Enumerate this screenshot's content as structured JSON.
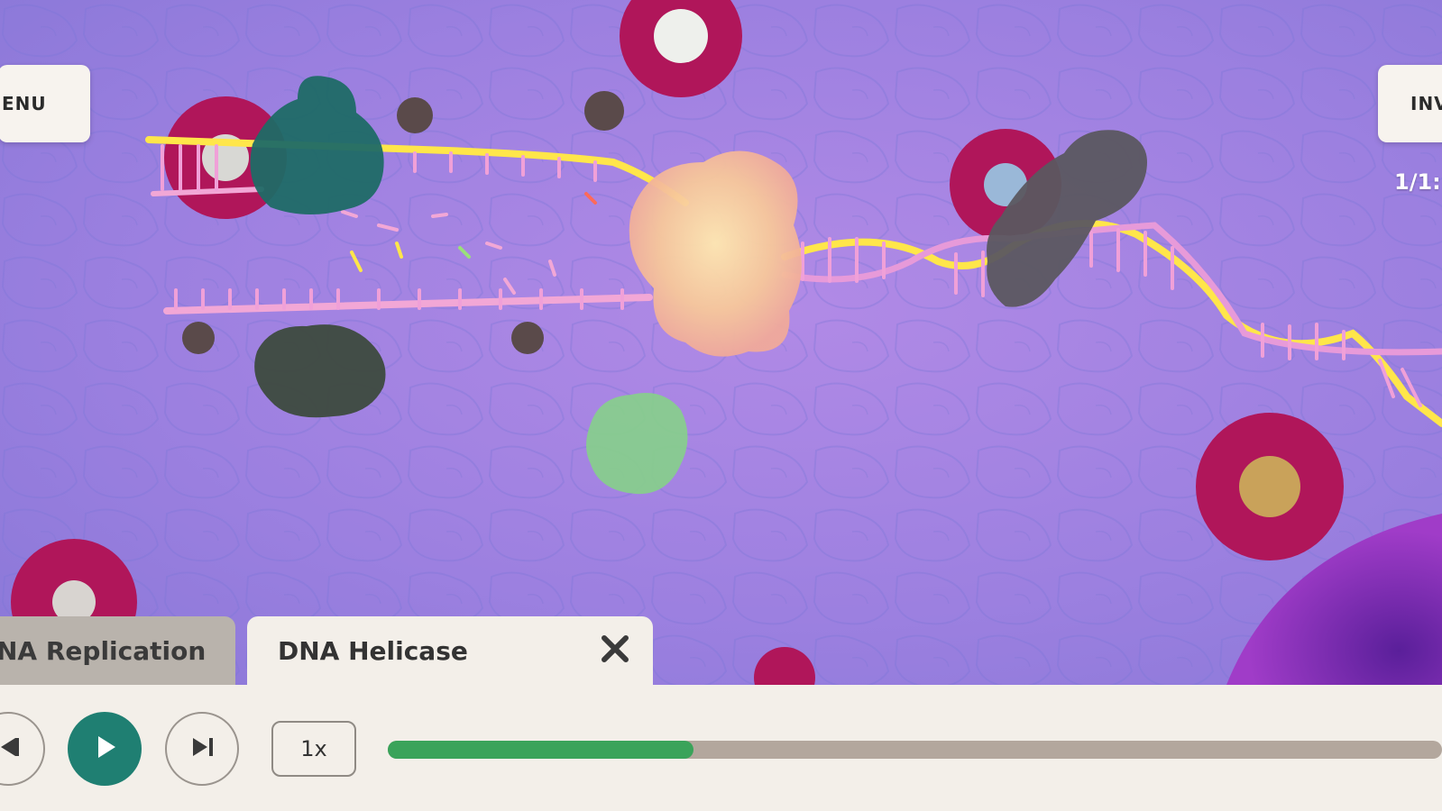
{
  "header": {
    "menu_label": "ENU",
    "inventory_label": "INV",
    "step_counter": "1/1:"
  },
  "tabs": [
    {
      "label": "NA Replication",
      "active": false
    },
    {
      "label": "DNA Helicase",
      "active": true
    }
  ],
  "playback": {
    "speed_label": "1x",
    "progress_fraction": 0.29,
    "state": "paused"
  },
  "colors": {
    "accent_teal": "#1f7f72",
    "progress_green": "#3aa35a",
    "panel_bg": "#f3efe9",
    "scene_purple": "#9b7fe0"
  },
  "icons": [
    "close-icon",
    "prev-icon",
    "play-icon",
    "next-icon"
  ]
}
